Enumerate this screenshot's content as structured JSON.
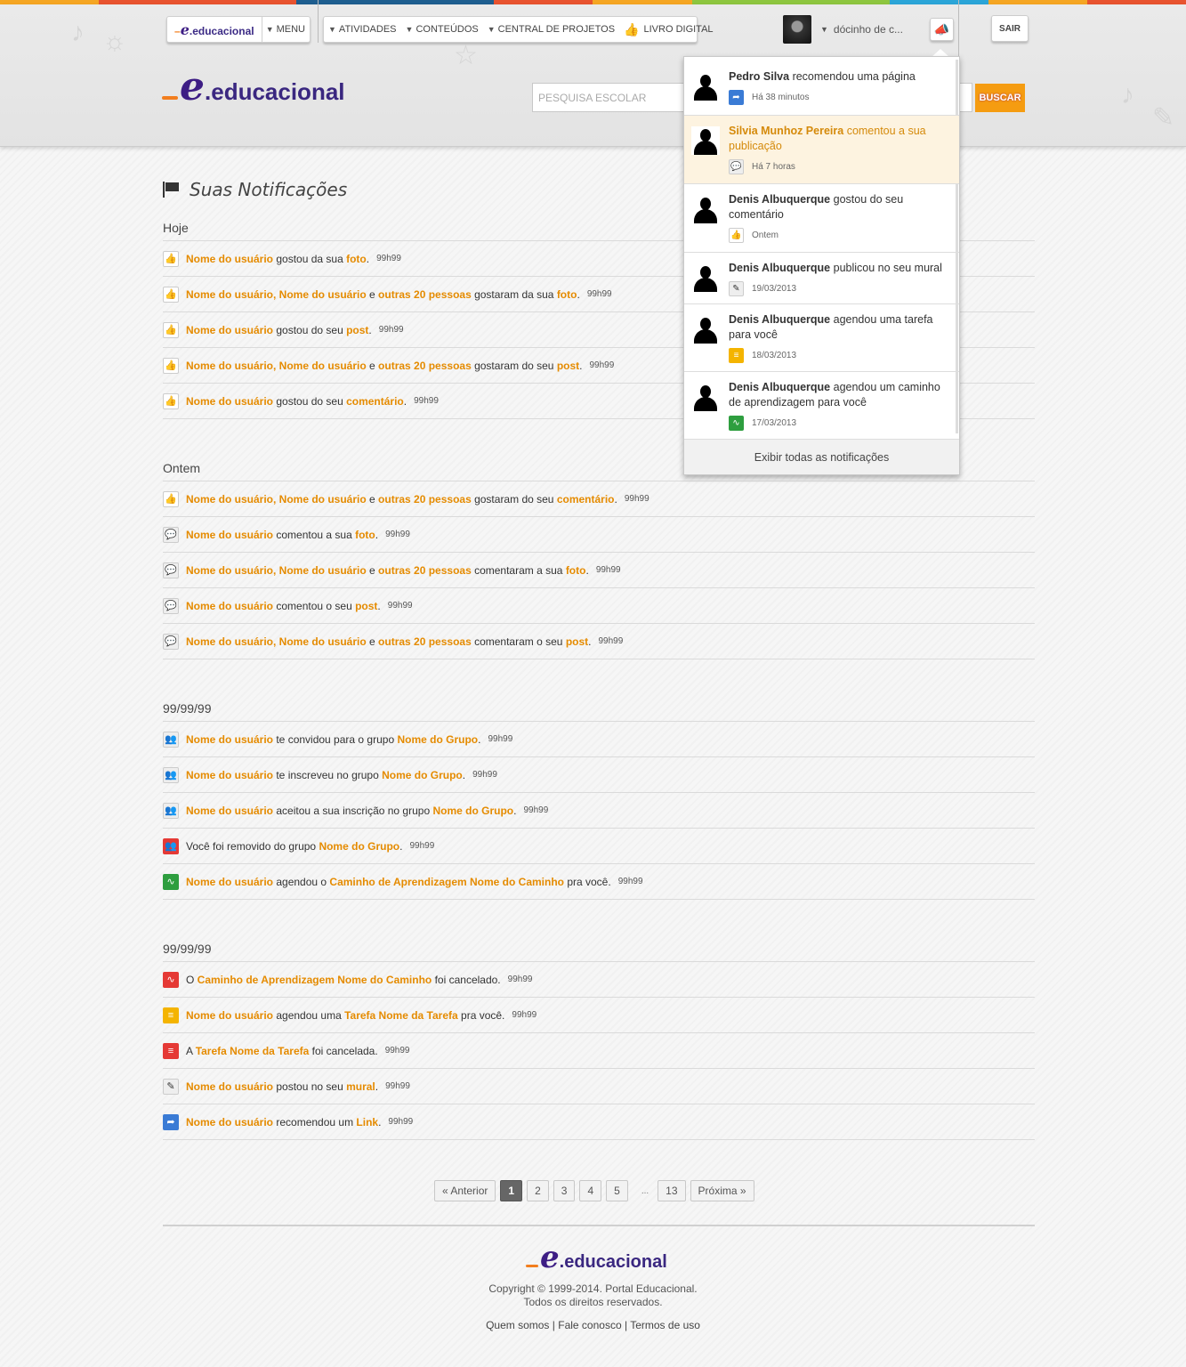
{
  "stripe_colors": [
    "#f5a623",
    "#e8532f",
    "#e8532f",
    "#1e5e8f",
    "#1e5e8f",
    "#e8532f",
    "#f5a623",
    "#8dc63f",
    "#8dc63f",
    "#2ba5d8",
    "#f5a623",
    "#e8532f"
  ],
  "nav": {
    "logo_small": "educacional",
    "menu": "MENU",
    "atividades": "ATIVIDADES",
    "conteudos": "CONTEÚDOS",
    "central": "CENTRAL DE PROJETOS",
    "livro": "LIVRO DIGITAL",
    "profile_name": "dócinho de c...",
    "sair": "SAIR"
  },
  "logo": {
    "text": "educacional",
    "e": "e",
    "dot": "."
  },
  "search": {
    "placeholder": "PESQUISA ESCOLAR",
    "button": "BUSCAR"
  },
  "page_title": "Suas Notificações",
  "sections": [
    {
      "heading": "Hoje",
      "rows": [
        {
          "icon": "like",
          "parts": [
            [
              "h",
              "Nome do usuário"
            ],
            [
              "t",
              " gostou da sua "
            ],
            [
              "h",
              "foto"
            ],
            [
              "t",
              "."
            ]
          ],
          "time": "99h99"
        },
        {
          "icon": "like",
          "parts": [
            [
              "h",
              "Nome do usuário, Nome do usuário"
            ],
            [
              "t",
              " e "
            ],
            [
              "h",
              "outras 20 pessoas"
            ],
            [
              "t",
              " gostaram da sua "
            ],
            [
              "h",
              "foto"
            ],
            [
              "t",
              "."
            ]
          ],
          "time": "99h99"
        },
        {
          "icon": "like",
          "parts": [
            [
              "h",
              "Nome do usuário"
            ],
            [
              "t",
              " gostou do seu "
            ],
            [
              "h",
              "post"
            ],
            [
              "t",
              "."
            ]
          ],
          "time": "99h99"
        },
        {
          "icon": "like",
          "parts": [
            [
              "h",
              "Nome do usuário, Nome do usuário"
            ],
            [
              "t",
              " e "
            ],
            [
              "h",
              "outras 20 pessoas"
            ],
            [
              "t",
              " gostaram do seu "
            ],
            [
              "h",
              "post"
            ],
            [
              "t",
              "."
            ]
          ],
          "time": "99h99"
        },
        {
          "icon": "like",
          "parts": [
            [
              "h",
              "Nome do usuário"
            ],
            [
              "t",
              " gostou do seu "
            ],
            [
              "h",
              "comentário"
            ],
            [
              "t",
              "."
            ]
          ],
          "time": "99h99"
        }
      ]
    },
    {
      "heading": "Ontem",
      "rows": [
        {
          "icon": "like",
          "parts": [
            [
              "h",
              "Nome do usuário, Nome do usuário"
            ],
            [
              "t",
              " e "
            ],
            [
              "h",
              "outras 20 pessoas"
            ],
            [
              "t",
              " gostaram do seu "
            ],
            [
              "h",
              "comentário"
            ],
            [
              "t",
              "."
            ]
          ],
          "time": "99h99"
        },
        {
          "icon": "chat",
          "parts": [
            [
              "h",
              "Nome do usuário"
            ],
            [
              "t",
              " comentou a sua "
            ],
            [
              "h",
              "foto"
            ],
            [
              "t",
              "."
            ]
          ],
          "time": "99h99"
        },
        {
          "icon": "chat",
          "parts": [
            [
              "h",
              "Nome do usuário, Nome do usuário"
            ],
            [
              "t",
              " e "
            ],
            [
              "h",
              "outras 20 pessoas"
            ],
            [
              "t",
              " comentaram a sua "
            ],
            [
              "h",
              "foto"
            ],
            [
              "t",
              "."
            ]
          ],
          "time": "99h99"
        },
        {
          "icon": "chat",
          "parts": [
            [
              "h",
              "Nome do usuário"
            ],
            [
              "t",
              " comentou o seu "
            ],
            [
              "h",
              "post"
            ],
            [
              "t",
              "."
            ]
          ],
          "time": "99h99"
        },
        {
          "icon": "chat",
          "parts": [
            [
              "h",
              "Nome do usuário, Nome do usuário"
            ],
            [
              "t",
              " e "
            ],
            [
              "h",
              "outras 20 pessoas"
            ],
            [
              "t",
              " comentaram o seu "
            ],
            [
              "h",
              "post"
            ],
            [
              "t",
              "."
            ]
          ],
          "time": "99h99"
        }
      ]
    },
    {
      "heading": "99/99/99",
      "rows": [
        {
          "icon": "grp",
          "parts": [
            [
              "h",
              "Nome do usuário"
            ],
            [
              "t",
              " te convidou para o grupo "
            ],
            [
              "h",
              "Nome do Grupo"
            ],
            [
              "t",
              "."
            ]
          ],
          "time": "99h99"
        },
        {
          "icon": "grp",
          "parts": [
            [
              "h",
              "Nome do usuário"
            ],
            [
              "t",
              " te inscreveu no grupo "
            ],
            [
              "h",
              "Nome do Grupo"
            ],
            [
              "t",
              "."
            ]
          ],
          "time": "99h99"
        },
        {
          "icon": "grp",
          "parts": [
            [
              "h",
              "Nome do usuário"
            ],
            [
              "t",
              " aceitou a sua inscrição no grupo "
            ],
            [
              "h",
              "Nome do Grupo"
            ],
            [
              "t",
              "."
            ]
          ],
          "time": "99h99"
        },
        {
          "icon": "grpred",
          "parts": [
            [
              "t",
              "Você foi removido do grupo "
            ],
            [
              "h",
              "Nome do Grupo"
            ],
            [
              "t",
              "."
            ]
          ],
          "time": "99h99"
        },
        {
          "icon": "path",
          "parts": [
            [
              "h",
              "Nome do usuário"
            ],
            [
              "t",
              " agendou o "
            ],
            [
              "h",
              "Caminho de Aprendizagem Nome do Caminho"
            ],
            [
              "t",
              " pra você."
            ]
          ],
          "time": "99h99"
        }
      ]
    },
    {
      "heading": "99/99/99",
      "rows": [
        {
          "icon": "pathred",
          "parts": [
            [
              "t",
              "O "
            ],
            [
              "h",
              "Caminho de Aprendizagem Nome do Caminho"
            ],
            [
              "t",
              " foi cancelado."
            ]
          ],
          "time": "99h99"
        },
        {
          "icon": "task",
          "parts": [
            [
              "h",
              "Nome do usuário"
            ],
            [
              "t",
              " agendou uma "
            ],
            [
              "h",
              "Tarefa Nome da Tarefa"
            ],
            [
              "t",
              " pra você."
            ]
          ],
          "time": "99h99"
        },
        {
          "icon": "taskred",
          "parts": [
            [
              "t",
              "A "
            ],
            [
              "h",
              "Tarefa Nome da Tarefa"
            ],
            [
              "t",
              " foi cancelada."
            ]
          ],
          "time": "99h99"
        },
        {
          "icon": "pen",
          "parts": [
            [
              "h",
              "Nome do usuário"
            ],
            [
              "t",
              " postou no seu "
            ],
            [
              "h",
              "mural"
            ],
            [
              "t",
              "."
            ]
          ],
          "time": "99h99"
        },
        {
          "icon": "share",
          "parts": [
            [
              "h",
              "Nome do usuário"
            ],
            [
              "t",
              " recomendou um "
            ],
            [
              "h",
              "Link"
            ],
            [
              "t",
              "."
            ]
          ],
          "time": "99h99"
        }
      ]
    }
  ],
  "pager": {
    "prev": "« Anterior",
    "pages": [
      "1",
      "2",
      "3",
      "4",
      "5"
    ],
    "dots": "...",
    "last": "13",
    "next": "Próxima »",
    "current": "1"
  },
  "footer": {
    "logo": "educacional",
    "copyright": "Copyright © 1999-2014. Portal Educacional.",
    "rights": "Todos os direitos reservados.",
    "links": [
      "Quem somos",
      "Fale conosco",
      "Termos de uso"
    ],
    "sep": "|"
  },
  "dropdown": {
    "items": [
      {
        "name": "Pedro Silva",
        "action": " recomendou uma página",
        "time": "Há 38 minutos",
        "icon": "share",
        "highlight": false
      },
      {
        "name": "Silvia Munhoz Pereira",
        "action": " comentou a sua publicação",
        "time": "Há 7 horas",
        "icon": "chat",
        "highlight": true
      },
      {
        "name": "Denis Albuquerque",
        "action": " gostou do seu comentário",
        "time": "Ontem",
        "icon": "like",
        "highlight": false
      },
      {
        "name": "Denis Albuquerque",
        "action": " publicou no seu mural",
        "time": "19/03/2013",
        "icon": "pen",
        "highlight": false
      },
      {
        "name": "Denis Albuquerque",
        "action": " agendou uma tarefa para você",
        "time": "18/03/2013",
        "icon": "task",
        "highlight": false
      },
      {
        "name": "Denis Albuquerque",
        "action": " agendou um caminho de aprendizagem para você",
        "time": "17/03/2013",
        "icon": "path",
        "highlight": false
      }
    ],
    "footer": "Exibir todas as notificações"
  }
}
